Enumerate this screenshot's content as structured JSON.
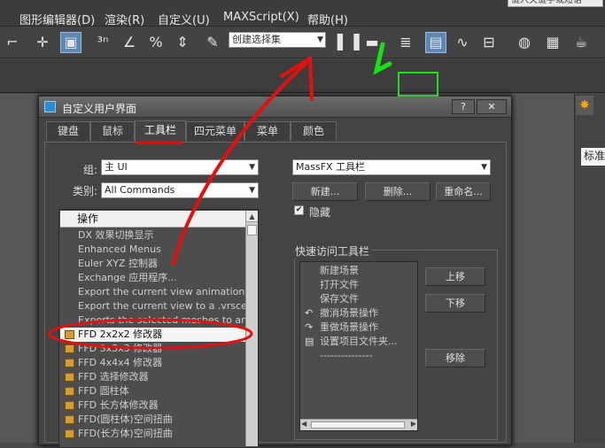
{
  "menubar": {
    "items": [
      "图形编辑器(D)",
      "渲染(R)",
      "自定义(U)",
      "MAXScript(X)",
      "帮助(H)"
    ],
    "search_placeholder": "键入关键字或短语"
  },
  "toolbar": {
    "selection_set_placeholder": "创建选择集",
    "icons": [
      "selection-brackets-icon",
      "move-icon",
      "select-region-icon",
      "snap-3d-icon",
      "angle-snap-icon",
      "percent-snap-icon",
      "spinner-snap-icon",
      "edit-named-sets-icon",
      "mirror-icon",
      "align-icon",
      "layer-manager-icon",
      "scene-explorer-icon",
      "curve-editor-icon",
      "schematic-view-icon",
      "material-editor-icon",
      "render-setup-icon",
      "render-teapot-icon"
    ]
  },
  "right_panel": {
    "field_text": "标准"
  },
  "dialog": {
    "title": "自定义用户界面",
    "help_label": "?",
    "close_label": "✕",
    "tabs": [
      "键盘",
      "鼠标",
      "工具栏",
      "四元菜单",
      "菜单",
      "颜色"
    ],
    "active_tab": "工具栏",
    "group_label": "组:",
    "group_value": "主 UI",
    "category_label": "类别:",
    "category_value": "All Commands",
    "action_header": "操作",
    "actions": [
      "DX 效果切换显示",
      "Enhanced Menus",
      "Euler XYZ 控制器",
      "Exchange 应用程序...",
      "Export the current view animation to ...",
      "Export the current view to a .vrscene...",
      "Exports the selected meshes to an ex...",
      "FFD 2x2x2 修改器",
      "FFD 3x3x3 修改器",
      "FFD 4x4x4 修改器",
      "FFD 选择修改器",
      "FFD 圆柱体",
      "FFD 长方体修改器",
      "FFD(圆柱体)空间扭曲",
      "FFD(长方体)空间扭曲"
    ],
    "selected_action": "FFD 2x2x2 修改器",
    "toolbar_select_value": "MassFX 工具栏",
    "new_label": "新建...",
    "delete_label": "删除...",
    "rename_label": "重命名...",
    "hide_label": "隐藏",
    "hide_checked": true,
    "quick_access_title": "快速访问工具栏",
    "quick_items": [
      "新建场景",
      "打开文件",
      "保存文件",
      "撤消场景操作",
      "重做场景操作",
      "设置项目文件夹...",
      "---------------"
    ],
    "move_up_label": "上移",
    "move_down_label": "下移",
    "remove_label": "移除"
  },
  "colors": {
    "annotation_red": "#e31010",
    "annotation_green": "#19e019",
    "selection_highlight": "#5d87b5"
  }
}
